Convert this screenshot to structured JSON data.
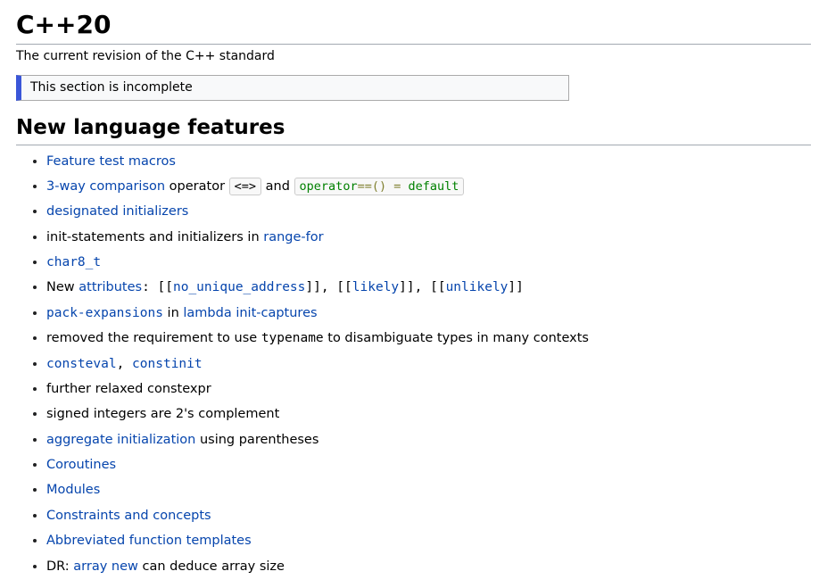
{
  "title": "C++20",
  "subtitle": "The current revision of the C++ standard",
  "incomplete_notice": "This section is incomplete",
  "section_heading": "New language features",
  "items": {
    "feature_test_macros": "Feature test macros",
    "three_way_comparison": "3-way comparison",
    "operator_word": " operator ",
    "spaceship_op": "<=>",
    "and_word": " and ",
    "op_eq_kw": "operator",
    "op_eq_sym1": "==",
    "op_eq_paren": "()",
    "op_eq_sp": " ",
    "op_eq_assign": "=",
    "op_eq_default": "default",
    "designated_initializers": "designated initializers",
    "init_statements_prefix": "init-statements and initializers in ",
    "range_for": "range-for",
    "char8_t": "char8_t",
    "new_word": "New ",
    "attributes_link": "attributes",
    "attr_open1": ": [[",
    "no_unique_address": "no_unique_address",
    "attr_mid1": "]], [[",
    "likely": "likely",
    "attr_mid2": "]], [[",
    "unlikely": "unlikely",
    "attr_close": "]]",
    "pack_expansions": "pack-expansions",
    "in_word": " in ",
    "lambda_init_captures": "lambda init-captures",
    "typename_text_1": "removed the requirement to use ",
    "typename_code": "typename",
    "typename_text_2": " to disambiguate types in many contexts",
    "consteval": "consteval",
    "comma_sep": ", ",
    "constinit": "constinit",
    "relaxed_constexpr": "further relaxed constexpr",
    "signed_int": "signed integers are 2's complement",
    "aggregate_init": "aggregate initialization",
    "using_paren": " using parentheses",
    "coroutines": "Coroutines",
    "modules": "Modules",
    "constraints_concepts": "Constraints and concepts",
    "abbrev_templates": "Abbreviated function templates",
    "dr_prefix": "DR: ",
    "array_new": "array new",
    "deduce_size": " can deduce array size"
  }
}
